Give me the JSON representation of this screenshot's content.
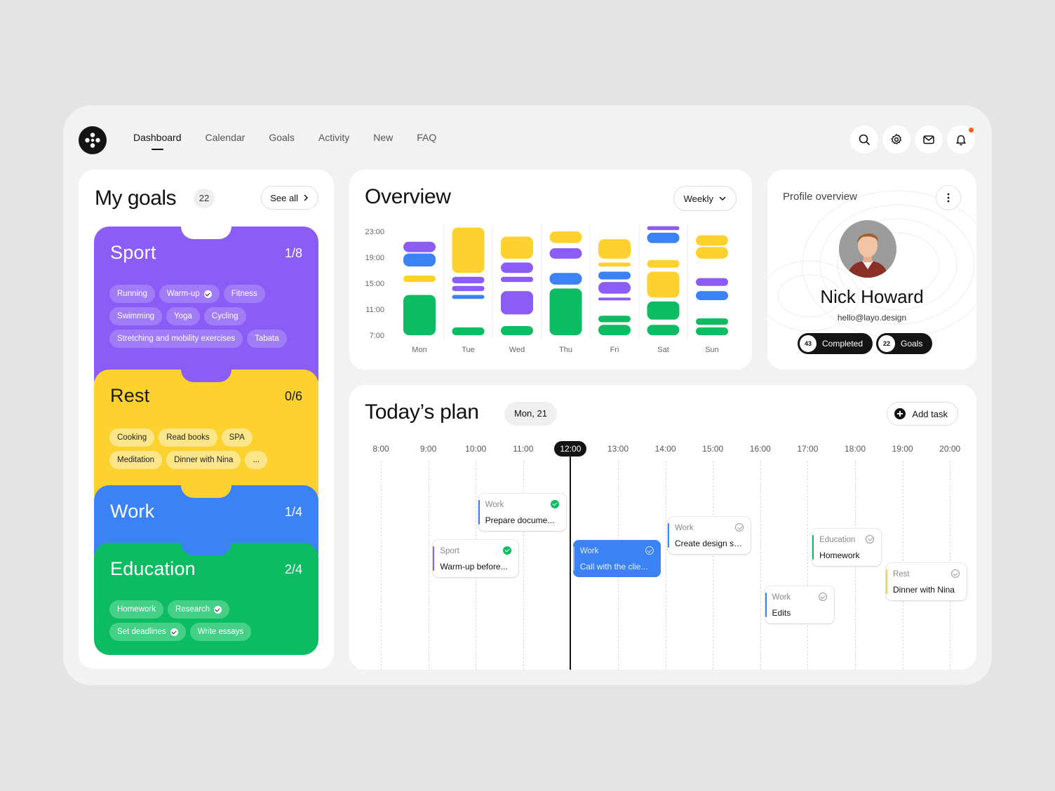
{
  "nav": {
    "items": [
      "Dashboard",
      "Calendar",
      "Goals",
      "Activity",
      "New",
      "FAQ"
    ],
    "active": "Dashboard"
  },
  "top_icons": [
    "search-icon",
    "gear-icon",
    "mail-icon",
    "bell-icon"
  ],
  "goals": {
    "title": "My goals",
    "count": "22",
    "see_all": "See all",
    "groups": [
      {
        "name": "Sport",
        "progress": "1/8",
        "color": "#8b5cf6",
        "items": [
          {
            "label": "Running",
            "done": false
          },
          {
            "label": "Warm-up",
            "done": true
          },
          {
            "label": "Fitness",
            "done": false
          },
          {
            "label": "Swimming",
            "done": false
          },
          {
            "label": "Yoga",
            "done": false
          },
          {
            "label": "Cycling",
            "done": false
          },
          {
            "label": "Stretching and mobility exercises",
            "done": false
          },
          {
            "label": "Tabata",
            "done": false
          }
        ]
      },
      {
        "name": "Rest",
        "progress": "0/6",
        "color": "#fdd22f",
        "items": [
          {
            "label": "Cooking",
            "done": false
          },
          {
            "label": "Read books",
            "done": false
          },
          {
            "label": "SPA",
            "done": false
          },
          {
            "label": "Meditation",
            "done": false
          },
          {
            "label": "Dinner with Nina",
            "done": false
          },
          {
            "label": "...",
            "done": false
          }
        ]
      },
      {
        "name": "Work",
        "progress": "1/4",
        "color": "#3b82f6",
        "items": []
      },
      {
        "name": "Education",
        "progress": "2/4",
        "color": "#0cbc62",
        "items": [
          {
            "label": "Homework",
            "done": false
          },
          {
            "label": "Research",
            "done": true
          },
          {
            "label": "Set deadlines",
            "done": true
          },
          {
            "label": "Write essays",
            "done": false
          }
        ]
      }
    ]
  },
  "overview": {
    "title": "Overview",
    "period": "Weekly"
  },
  "chart_data": {
    "type": "bar",
    "title": "Overview",
    "categories": [
      "Mon",
      "Tue",
      "Wed",
      "Thu",
      "Fri",
      "Sat",
      "Sun"
    ],
    "y_ticks": [
      "23:00",
      "19:00",
      "15:00",
      "11:00",
      "7:00"
    ],
    "ylim": [
      7,
      24
    ],
    "legend": "none",
    "grid": false,
    "segment_colors": {
      "Sport": "#8b5cf6",
      "Rest": "#fdd22f",
      "Work": "#3b82f6",
      "Education": "#0cbc62"
    },
    "segments": [
      [
        [
          "Education",
          7.0,
          13.2
        ],
        [
          "Rest",
          15.2,
          16.2
        ],
        [
          "Work",
          17.6,
          19.6
        ],
        [
          "Sport",
          19.8,
          21.4
        ]
      ],
      [
        [
          "Education",
          7.0,
          8.2
        ],
        [
          "Work",
          12.6,
          13.2
        ],
        [
          "Sport",
          13.8,
          14.6
        ],
        [
          "Sport",
          15.0,
          16.0
        ],
        [
          "Rest",
          16.6,
          23.6
        ]
      ],
      [
        [
          "Education",
          7.0,
          8.4
        ],
        [
          "Sport",
          10.2,
          13.8
        ],
        [
          "Sport",
          15.2,
          16.0
        ],
        [
          "Sport",
          16.6,
          18.2
        ],
        [
          "Rest",
          18.8,
          22.2
        ]
      ],
      [
        [
          "Education",
          7.0,
          14.2
        ],
        [
          "Work",
          14.8,
          16.6
        ],
        [
          "Sport",
          18.8,
          20.4
        ],
        [
          "Rest",
          21.2,
          23.0
        ]
      ],
      [
        [
          "Education",
          7.0,
          8.6
        ],
        [
          "Education",
          9.0,
          10.0
        ],
        [
          "Sport",
          12.4,
          12.8
        ],
        [
          "Sport",
          13.4,
          15.2
        ],
        [
          "Work",
          15.6,
          16.8
        ],
        [
          "Rest",
          17.6,
          18.2
        ],
        [
          "Rest",
          18.8,
          21.8
        ]
      ],
      [
        [
          "Education",
          7.0,
          8.6
        ],
        [
          "Education",
          9.4,
          12.2
        ],
        [
          "Rest",
          12.8,
          16.8
        ],
        [
          "Rest",
          17.4,
          18.6
        ],
        [
          "Work",
          21.2,
          22.8
        ],
        [
          "Sport",
          23.2,
          23.8
        ]
      ],
      [
        [
          "Education",
          7.0,
          8.2
        ],
        [
          "Education",
          8.6,
          9.6
        ],
        [
          "Work",
          12.4,
          13.8
        ],
        [
          "Sport",
          14.6,
          15.8
        ],
        [
          "Rest",
          18.8,
          20.6
        ],
        [
          "Rest",
          20.8,
          22.4
        ]
      ]
    ]
  },
  "profile": {
    "title": "Profile overview",
    "name": "Nick Howard",
    "email": "hello@layo.design",
    "completed_count": "43",
    "completed_label": "Completed",
    "goals_count": "22",
    "goals_label": "Goals"
  },
  "plan": {
    "title": "Today’s plan",
    "date": "Mon, 21",
    "add_task": "Add task",
    "hours": [
      "8:00",
      "9:00",
      "10:00",
      "11:00",
      "12:00",
      "13:00",
      "14:00",
      "15:00",
      "16:00",
      "17:00",
      "18:00",
      "19:00",
      "20:00"
    ],
    "current_hour": "12:00",
    "tasks": [
      {
        "category": "Sport",
        "title": "Warm-up before...",
        "done": true,
        "color": "#8b5cf6",
        "start": 9.1,
        "end": 10.9,
        "lane": 3
      },
      {
        "category": "Work",
        "title": "Prepare docume...",
        "done": true,
        "color": "#3b82f6",
        "start": 10.05,
        "end": 11.9,
        "lane": 1
      },
      {
        "category": "Work",
        "title": "Call with the clie...",
        "done": false,
        "color": "#3b82f6",
        "start": 12.05,
        "end": 13.9,
        "lane": 3,
        "highlight": true
      },
      {
        "category": "Work",
        "title": "Create design system",
        "done": false,
        "color": "#3b82f6",
        "start": 14.05,
        "end": 15.8,
        "lane": 2
      },
      {
        "category": "Education",
        "title": "Homework",
        "done": false,
        "color": "#0cbc62",
        "start": 17.1,
        "end": 18.55,
        "lane": 2.5
      },
      {
        "category": "Work",
        "title": "Edits",
        "done": false,
        "color": "#3b82f6",
        "start": 16.1,
        "end": 17.55,
        "lane": 5
      },
      {
        "category": "Rest",
        "title": "Dinner with Nina",
        "done": false,
        "color": "#fdd22f",
        "start": 18.65,
        "end": 20.35,
        "lane": 4
      }
    ]
  }
}
